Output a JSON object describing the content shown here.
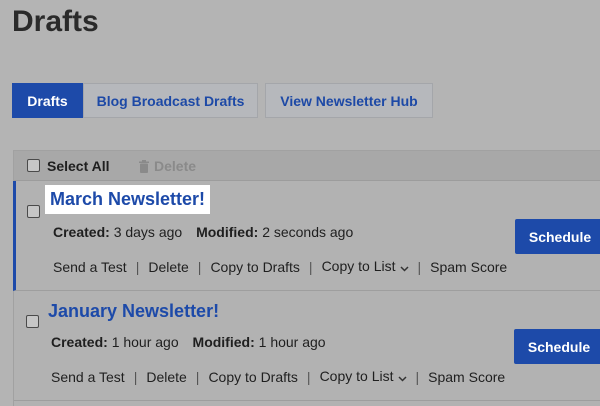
{
  "page": {
    "title": "Drafts"
  },
  "tabs": [
    {
      "label": "Drafts",
      "active": true
    },
    {
      "label": "Blog Broadcast Drafts",
      "active": false
    },
    {
      "label": "View Newsletter Hub",
      "active": false
    }
  ],
  "list_header": {
    "select_all": "Select All",
    "delete": "Delete"
  },
  "drafts": [
    {
      "title": "March Newsletter!",
      "created_label": "Created:",
      "created": "3 days ago",
      "modified_label": "Modified:",
      "modified": "2 seconds ago",
      "actions": [
        "Send a Test",
        "Delete",
        "Copy to Drafts",
        "Copy to List",
        "Spam Score"
      ],
      "schedule": "Schedule"
    },
    {
      "title": "January Newsletter!",
      "created_label": "Created:",
      "created": "1 hour ago",
      "modified_label": "Modified:",
      "modified": "1 hour ago",
      "actions": [
        "Send a Test",
        "Delete",
        "Copy to Drafts",
        "Copy to List",
        "Spam Score"
      ],
      "schedule": "Schedule"
    }
  ],
  "colors": {
    "primary": "#1d4aa9",
    "overlay_bg": "#b4b4b4"
  },
  "icons": {
    "delete": "trash-icon",
    "copy_to_list": "chevron-down-icon"
  }
}
